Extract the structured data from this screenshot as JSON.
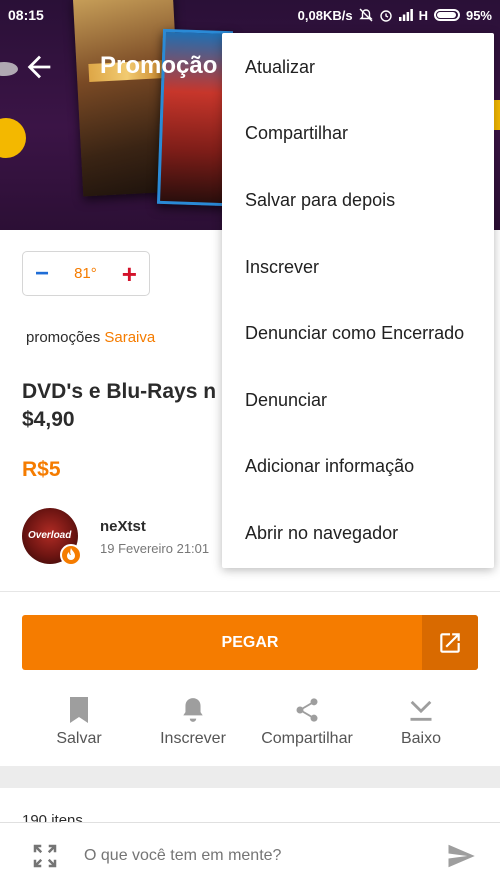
{
  "status_bar": {
    "time": "08:15",
    "network_speed": "0,08KB/s",
    "network_type": "H",
    "battery": "95%"
  },
  "header": {
    "title": "Promoção"
  },
  "vote": {
    "minus": "−",
    "value": "81°",
    "plus": "+"
  },
  "deal": {
    "store_prefix": "promoções",
    "store_name": "Saraiva",
    "title": "DVD's e Blu-Rays n\n$4,90",
    "price": "R$5"
  },
  "author": {
    "avatar_text": "Overload",
    "name": "neXtst",
    "posted": "19 Fevereiro 21:01"
  },
  "cta": {
    "label": "PEGAR"
  },
  "actions": [
    {
      "label": "Salvar",
      "icon": "bookmark-icon"
    },
    {
      "label": "Inscrever",
      "icon": "bell-icon"
    },
    {
      "label": "Compartilhar",
      "icon": "share-icon"
    },
    {
      "label": "Baixo",
      "icon": "vote-down-icon"
    }
  ],
  "comments": {
    "count_label": "190 itens"
  },
  "composer": {
    "placeholder": "O que você tem em mente?"
  },
  "menu": {
    "items": [
      "Atualizar",
      "Compartilhar",
      "Salvar para depois",
      "Inscrever",
      "Denunciar como Encerrado",
      "Denunciar",
      "Adicionar informação",
      "Abrir no navegador"
    ]
  },
  "colors": {
    "accent": "#f57c00",
    "vote_down": "#1f6dd6",
    "vote_up": "#d3122a"
  }
}
